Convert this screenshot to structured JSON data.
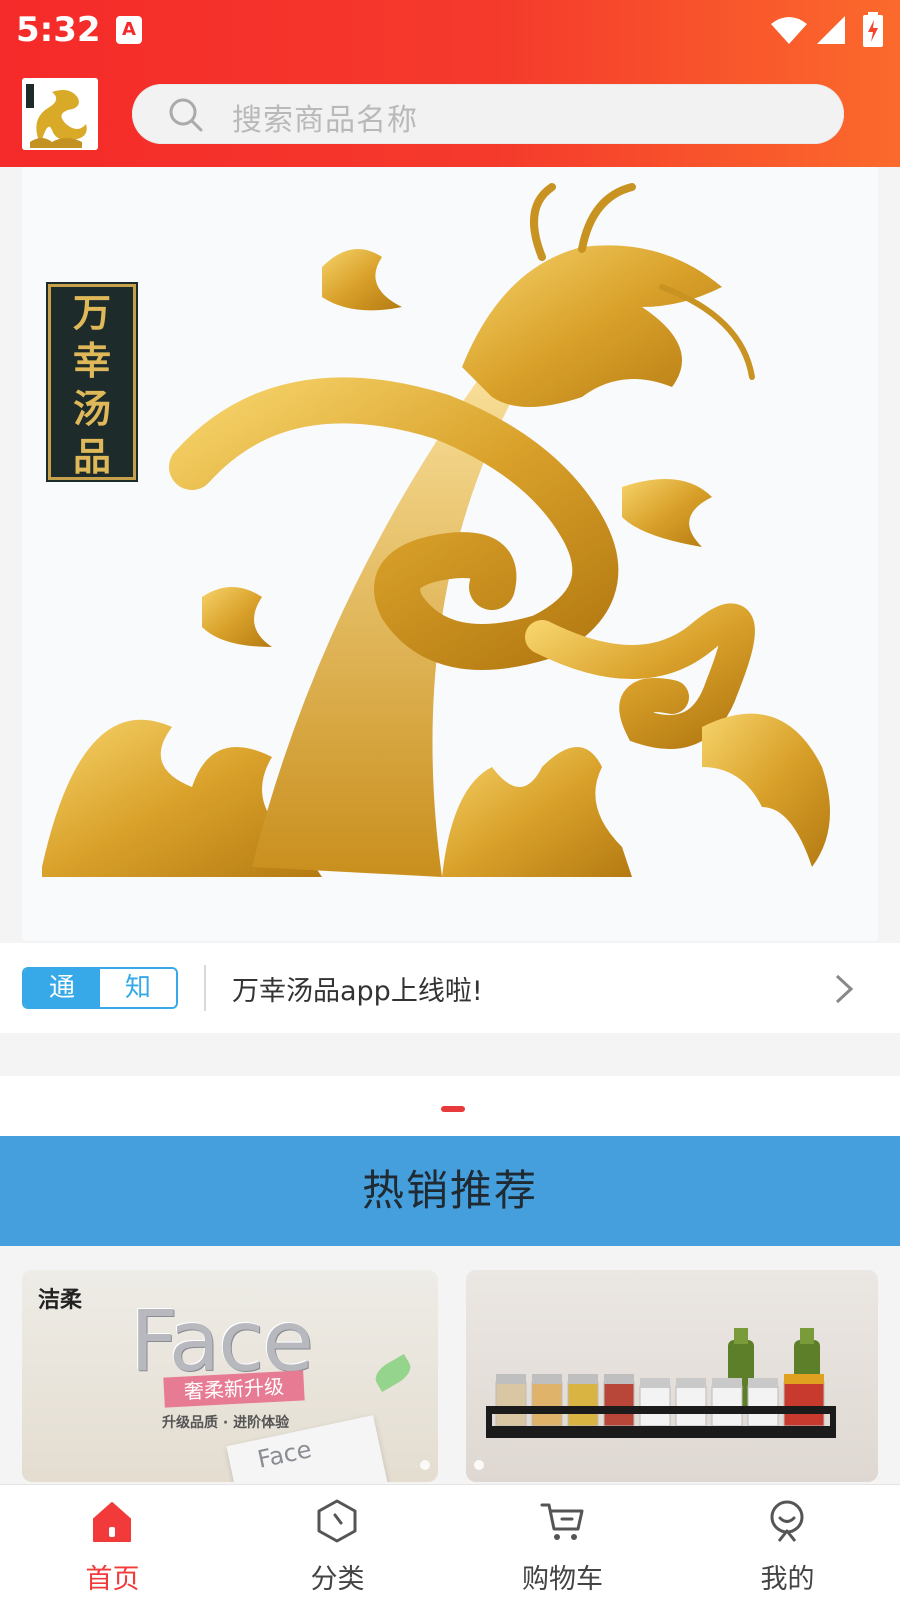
{
  "status_bar": {
    "time": "5:32",
    "notification_icon": "A"
  },
  "header": {
    "logo_icon": "dragon-logo",
    "search_placeholder": "搜索商品名称"
  },
  "banner": {
    "plaque_chars": [
      "万",
      "幸",
      "汤",
      "品"
    ]
  },
  "notice": {
    "tag_left": "通",
    "tag_right": "知",
    "message": "万幸汤品app上线啦!"
  },
  "section": {
    "title": "热销推荐"
  },
  "products": [
    {
      "brand": "洁柔",
      "title": "Face",
      "ribbon": "奢柔新升级",
      "slogan": "升级品质 · 进阶体验",
      "box_text": "Face"
    },
    {
      "image": "spice-rack"
    }
  ],
  "nav": {
    "items": [
      {
        "label": "首页",
        "icon": "home-icon",
        "active": true
      },
      {
        "label": "分类",
        "icon": "category-icon",
        "active": false
      },
      {
        "label": "购物车",
        "icon": "cart-icon",
        "active": false
      },
      {
        "label": "我的",
        "icon": "profile-icon",
        "active": false
      }
    ]
  },
  "colors": {
    "header_red": "#f52a2a",
    "accent_blue": "#449fdc",
    "tag_blue": "#38a9e8",
    "active_red": "#f23a3a"
  }
}
